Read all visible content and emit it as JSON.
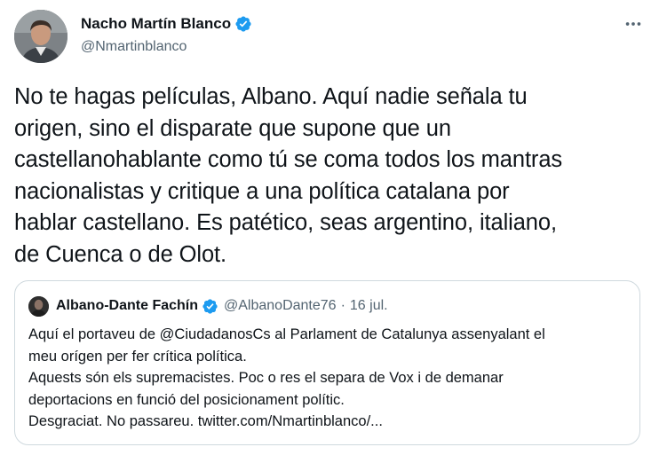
{
  "tweet": {
    "author": {
      "display_name": "Nacho Martín Blanco",
      "handle": "@Nmartinblanco",
      "verified": true
    },
    "text": "No te hagas películas, Albano. Aquí nadie señala tu\norigen, sino el disparate que supone que un\ncastellanohablante como tú se coma todos los mantras\nnacionalistas y critique a una política catalana por\nhablar castellano. Es patético, seas argentino, italiano,\nde Cuenca o de Olot.",
    "more_icon": "more-horizontal-icon"
  },
  "quoted_tweet": {
    "author": {
      "display_name": "Albano-Dante Fachín",
      "handle": "@AlbanoDante76",
      "verified": true
    },
    "separator": "·",
    "date": "16 jul.",
    "text": "Aquí el portaveu de @CiudadanosCs al Parlament de Catalunya assenyalant el\nmeu orígen per fer crítica política.\nAquests són els supremacistes. Poc o res el separa de Vox i de demanar\ndeportacions en funció del posicionament polític.\nDesgraciat. No passareu. twitter.com/Nmartinblanco/..."
  },
  "colors": {
    "text_primary": "#0f1419",
    "text_secondary": "#536471",
    "verified_blue": "#1d9bf0",
    "border": "#cfd9de"
  }
}
